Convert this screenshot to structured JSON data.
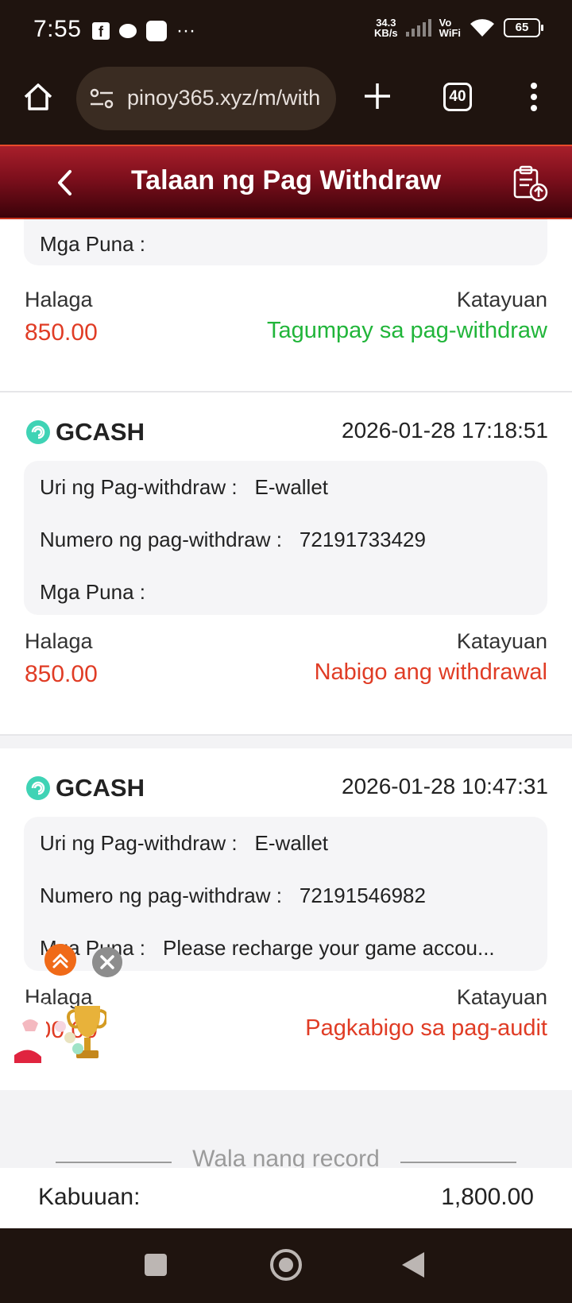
{
  "status_bar": {
    "time": "7:55",
    "fb_letter": "f",
    "speed_top": "34.3",
    "speed_bottom": "KB/s",
    "vo": "Vo",
    "wifi": "WiFi",
    "battery": "65"
  },
  "browser": {
    "url": "pinoy365.xyz/m/with",
    "tab_count": "40"
  },
  "header": {
    "title": "Talaan ng Pag Withdraw"
  },
  "records": [
    {
      "remarks_label": "Mga Puna :",
      "remarks_value": "",
      "amount_label": "Halaga",
      "amount": "850.00",
      "status_label": "Katayuan",
      "status": "Tagumpay sa pag-withdraw",
      "status_color": "#21b53a"
    },
    {
      "provider": "GCASH",
      "datetime": "2026-01-28 17:18:51",
      "type_label": "Uri ng Pag-withdraw :",
      "type_value": "E-wallet",
      "number_label": "Numero ng pag-withdraw :",
      "number_value": "72191733429",
      "remarks_label": "Mga Puna :",
      "remarks_value": "",
      "amount_label": "Halaga",
      "amount": "850.00",
      "status_label": "Katayuan",
      "status": "Nabigo ang withdrawal",
      "status_color": "#e03c25"
    },
    {
      "provider": "GCASH",
      "datetime": "2026-01-28 10:47:31",
      "type_label": "Uri ng Pag-withdraw :",
      "type_value": "E-wallet",
      "number_label": "Numero ng pag-withdraw :",
      "number_value": "72191546982",
      "remarks_label": "Mga Puna :",
      "remarks_value": "Please recharge your game accou...",
      "amount_label": "Halaga",
      "amount": "100.00",
      "status_label": "Katayuan",
      "status": "Pagkabigo sa pag-audit",
      "status_color": "#e03c25"
    }
  ],
  "no_more": "Wala nang record",
  "total": {
    "label": "Kabuuan:",
    "value": "1,800.00"
  },
  "icons": {
    "home": "home-icon",
    "tune": "site-settings-icon",
    "plus": "new-tab-icon",
    "menu": "more-vert-icon",
    "back": "chevron-left-icon",
    "record": "clipboard-upload-icon",
    "gcash": "gcash-logo-icon"
  }
}
